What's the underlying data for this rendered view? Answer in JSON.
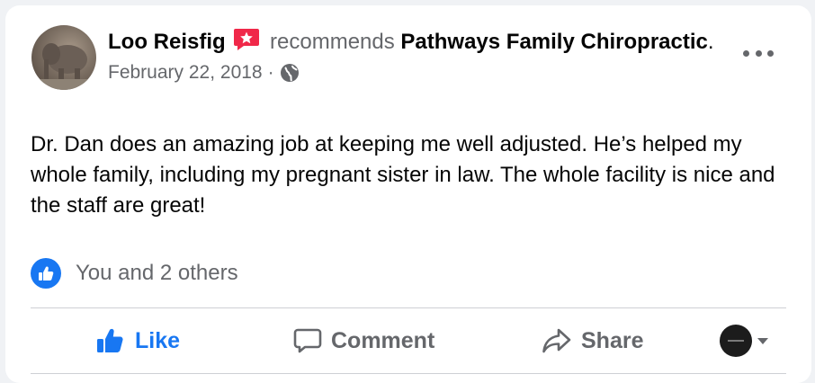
{
  "post": {
    "author": "Loo Reisfig",
    "action_text": "recommends",
    "page_name": "Pathways Family Chiropractic",
    "period": ".",
    "date": "February 22, 2018",
    "separator": "·",
    "audience_icon": "globe-icon",
    "body": "Dr. Dan does an amazing job at keeping me well adjusted. He’s helped my whole family, including my pregnant sister in law. The whole facility is nice and the staff are great!",
    "reactions_text": "You and 2 others"
  },
  "actions": {
    "like_label": "Like",
    "comment_label": "Comment",
    "share_label": "Share"
  },
  "colors": {
    "accent": "#1877f2",
    "muted": "#65676b",
    "badge": "#f02849"
  }
}
